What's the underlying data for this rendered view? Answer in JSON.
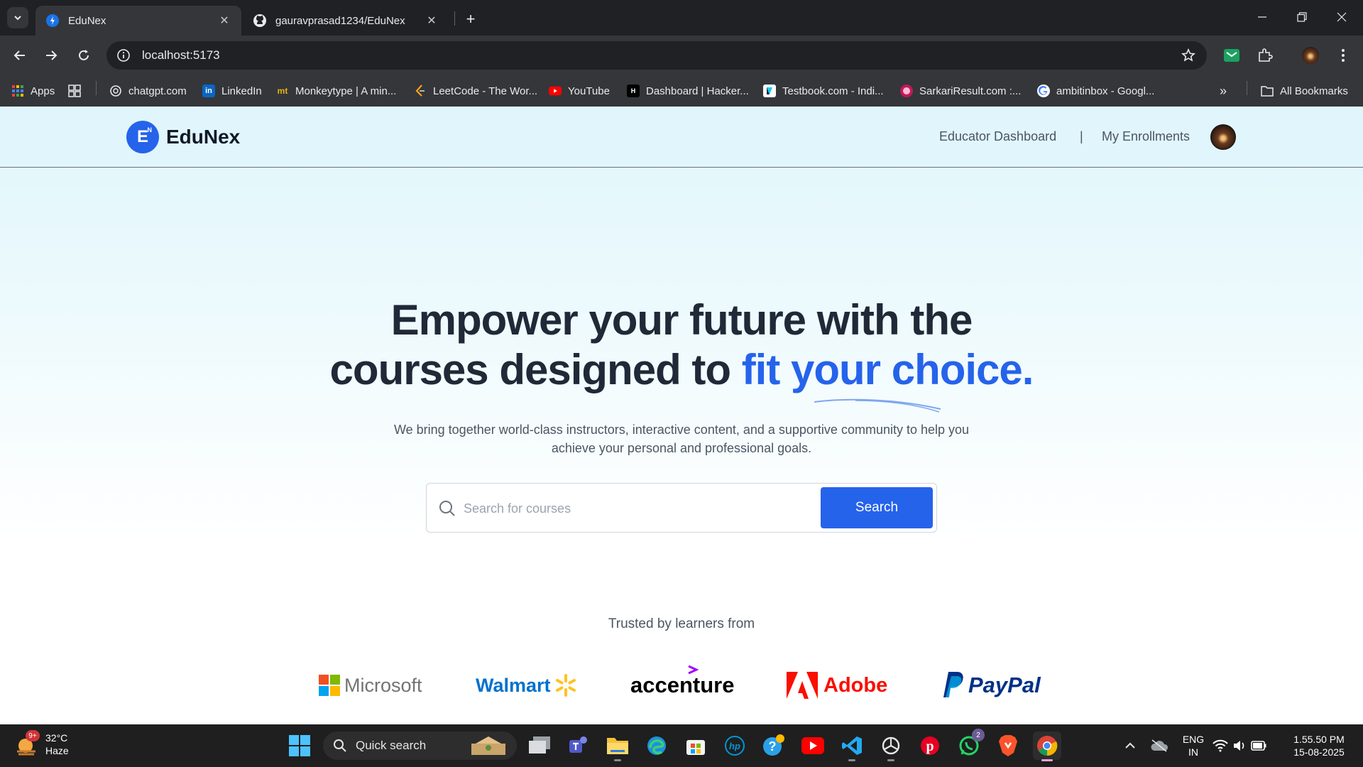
{
  "browser": {
    "tabs": [
      {
        "title": "EduNex",
        "active": true
      },
      {
        "title": "gauravprasad1234/EduNex",
        "active": false
      }
    ],
    "url": "localhost:5173",
    "bookmarks": [
      {
        "label": "Apps"
      },
      {
        "label": "chatgpt.com"
      },
      {
        "label": "LinkedIn"
      },
      {
        "label": "Monkeytype | A min..."
      },
      {
        "label": "LeetCode - The Wor..."
      },
      {
        "label": "YouTube"
      },
      {
        "label": "Dashboard | Hacker..."
      },
      {
        "label": "Testbook.com - Indi..."
      },
      {
        "label": "SarkariResult.com :..."
      },
      {
        "label": "ambitinbox - Googl..."
      }
    ],
    "all_bookmarks": "All Bookmarks"
  },
  "site": {
    "logo_mark": "E",
    "logo_sup": "N",
    "logo_text": "EduNex",
    "nav": {
      "educator": "Educator Dashboard",
      "separator": "|",
      "enrollments": "My Enrollments"
    },
    "hero": {
      "title_line1": "Empower your future with the",
      "title_line2_plain": "courses designed to ",
      "title_line2_accent": "fit your choice.",
      "subtitle": "We bring together world-class instructors, interactive content, and a supportive community to help you achieve your personal and professional goals."
    },
    "search": {
      "placeholder": "Search for courses",
      "button": "Search"
    },
    "trusted": {
      "heading": "Trusted by learners from",
      "brands": [
        "Microsoft",
        "Walmart",
        "accenture",
        "Adobe",
        "PayPal"
      ]
    },
    "colors": {
      "accent": "#2563eb",
      "header_bg": "#e0f6fc",
      "text_dark": "#1f2937"
    }
  },
  "taskbar": {
    "weather": {
      "temp": "32°C",
      "condition": "Haze",
      "badge": "9+"
    },
    "quick_search": "Quick search",
    "whatsapp_badge": "2",
    "lang": {
      "line1": "ENG",
      "line2": "IN"
    },
    "clock": {
      "time": "1.55.50 PM",
      "date": "15-08-2025"
    }
  }
}
